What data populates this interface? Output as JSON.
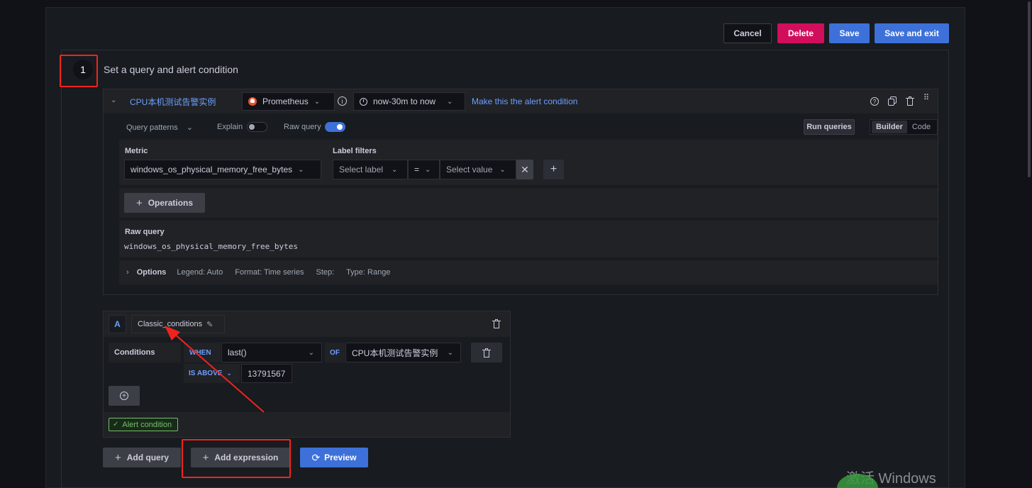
{
  "toolbar": {
    "cancel": "Cancel",
    "delete": "Delete",
    "save": "Save",
    "save_exit": "Save and exit"
  },
  "step": {
    "number": "1",
    "title": "Set a query and alert condition"
  },
  "query": {
    "name": "CPU本机测试告警实例",
    "datasource": "Prometheus",
    "time_range": "now-30m to now",
    "make_condition": "Make this the alert condition",
    "query_patterns": "Query patterns",
    "explain": "Explain",
    "raw_query_toggle": "Raw query",
    "run_queries": "Run queries",
    "builder": "Builder",
    "code": "Code",
    "metric_label": "Metric",
    "metric_value": "windows_os_physical_memory_free_bytes",
    "label_filters": "Label filters",
    "select_label": "Select label",
    "operator": "=",
    "select_value": "Select value",
    "operations": "Operations",
    "raw_query_label": "Raw query",
    "raw_query_value": "windows_os_physical_memory_free_bytes",
    "options": "Options",
    "legend": "Legend: Auto",
    "format": "Format: Time series",
    "step": "Step:",
    "type": "Type: Range"
  },
  "expression": {
    "ref": "A",
    "name": "Classic_conditions",
    "conditions_label": "Conditions",
    "when": "WHEN",
    "func": "last()",
    "of": "OF",
    "of_query": "CPU本机测试告警实例",
    "is_above": "IS ABOVE",
    "threshold": "13791567",
    "alert_condition": "Alert condition"
  },
  "actions": {
    "add_query": "Add query",
    "add_expression": "Add expression",
    "preview": "Preview"
  },
  "watermark": "激活 Windows",
  "colors": {
    "delete": "#d10e5c",
    "primary": "#3d71d9",
    "link": "#6e9fff",
    "toggle_on": "#3d71d9",
    "success": "#73bf69",
    "annotation": "#f0241c"
  }
}
